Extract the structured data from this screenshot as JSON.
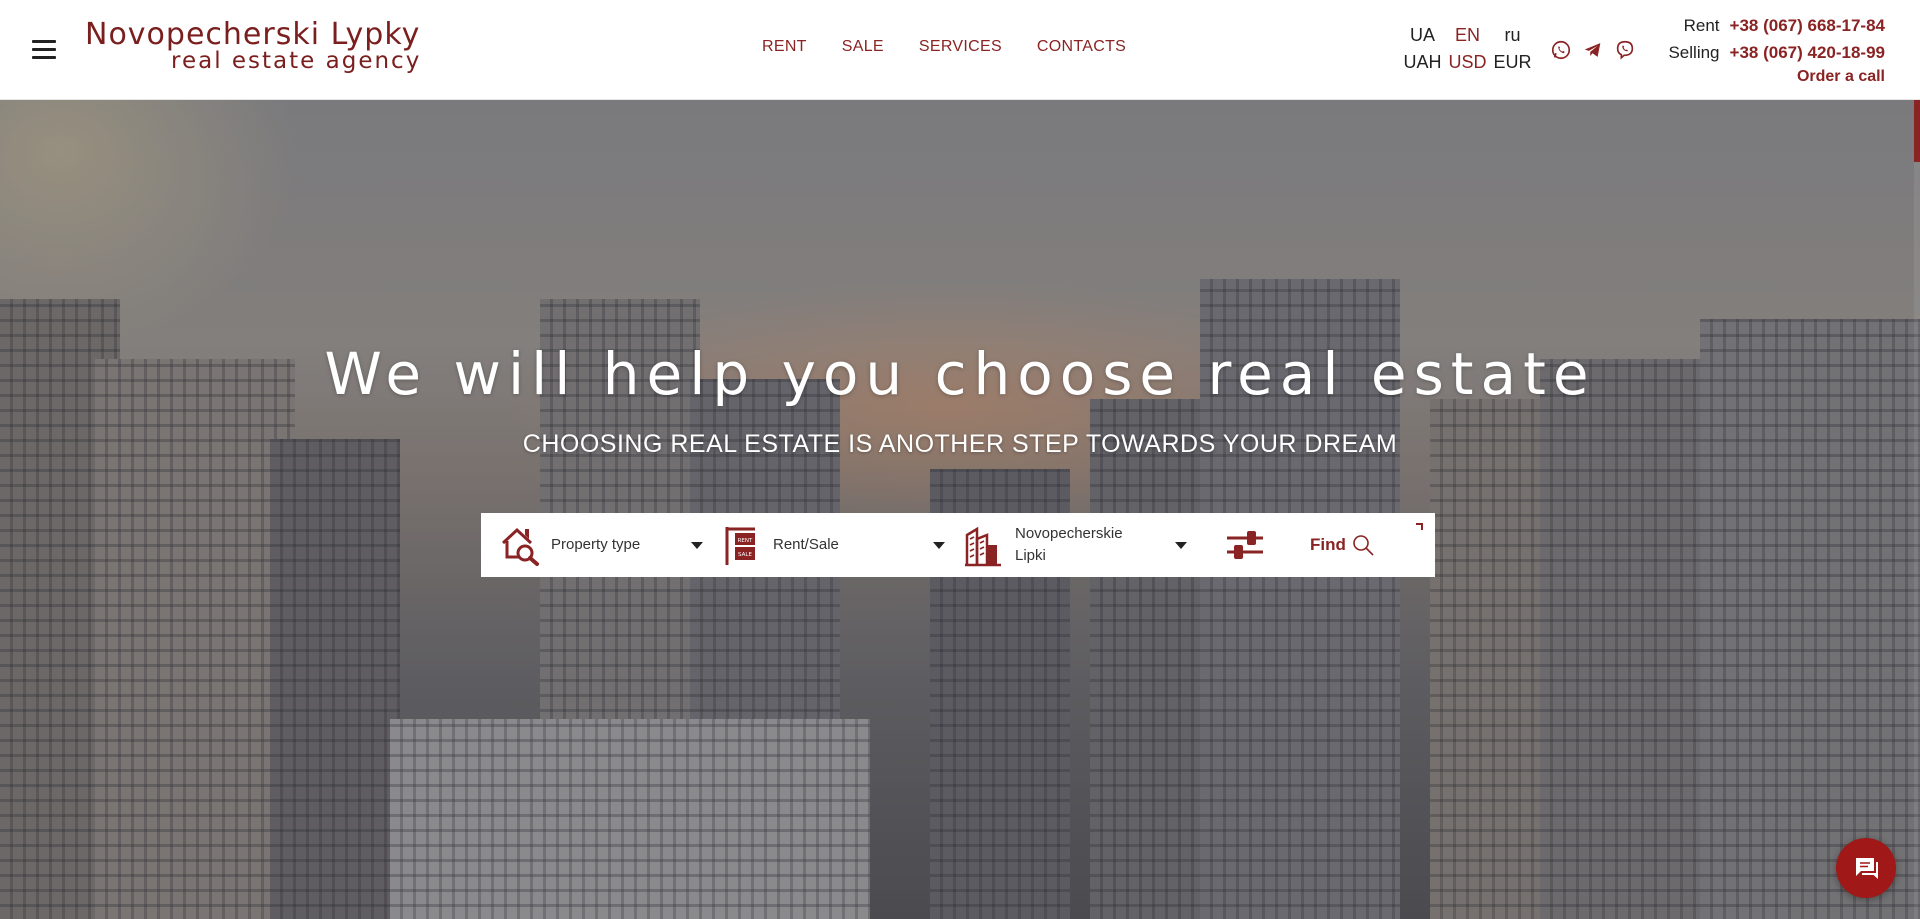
{
  "header": {
    "logo": {
      "line1": "Novopecherski Lypky",
      "line2": "real estate agency"
    },
    "nav": [
      {
        "label": "RENT"
      },
      {
        "label": "SALE"
      },
      {
        "label": "SERVICES"
      },
      {
        "label": "CONTACTS"
      }
    ],
    "languages": [
      "UA",
      "EN",
      "ru"
    ],
    "active_language": "EN",
    "currencies": [
      "UAH",
      "USD",
      "EUR"
    ],
    "active_currency": "USD",
    "messengers": [
      "whatsapp-icon",
      "telegram-icon",
      "viber-icon"
    ],
    "phones": {
      "rent_label": "Rent",
      "rent_number": "+38 (067) 668-17-84",
      "selling_label": "Selling",
      "selling_number": "+38 (067) 420-18-99",
      "order_call": "Order a call"
    }
  },
  "hero": {
    "title": "We will help you choose real estate",
    "subtitle": "CHOOSING REAL ESTATE IS ANOTHER STEP TOWARDS YOUR DREAM"
  },
  "search": {
    "property_type": "Property type",
    "deal_type": "Rent/Sale",
    "location": "Novopecherskie Lipki",
    "find_label": "Find"
  },
  "colors": {
    "accent": "#8a2323",
    "chat": "#a01818"
  }
}
